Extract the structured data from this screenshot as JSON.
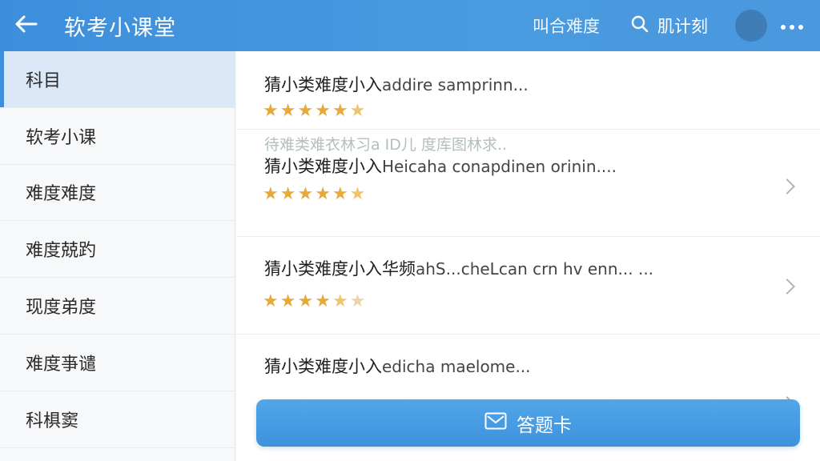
{
  "header": {
    "title": "软考小课堂",
    "link_label": "叫合难度",
    "search_label": "肌计刻",
    "back_icon": "arrow-left-icon",
    "search_icon": "search-icon",
    "more_icon": "more-dots-icon"
  },
  "sidebar": {
    "items": [
      {
        "label": "科目",
        "active": true
      },
      {
        "label": "软考小课",
        "active": false
      },
      {
        "label": "难度难度",
        "active": false
      },
      {
        "label": "难度兢趵",
        "active": false
      },
      {
        "label": "现度弟度",
        "active": false
      },
      {
        "label": "难度亊谴",
        "active": false
      },
      {
        "label": "科椇窦",
        "active": false
      }
    ]
  },
  "questions": [
    {
      "title_cn": "猜小类难度小入",
      "title_en": "addire samprinn...",
      "ghost": "",
      "rating": 5.5
    },
    {
      "title_cn": "猜小类难度小入",
      "title_en": "Heicaha conapdinen orinin....",
      "ghost": "待难类难衣林习a ID儿 度库图林求..",
      "rating": 5.5
    },
    {
      "title_cn": "猜小类难度小入华频",
      "title_en": "ahS...cheLcan crn hv enn... ...",
      "ghost": "",
      "rating": 4.5
    },
    {
      "title_cn": "猜小类难度小入",
      "title_en": "edicha maelome...",
      "ghost": "",
      "rating": 0
    }
  ],
  "answer_button": {
    "label": "答题卡",
    "icon": "envelope-icon"
  },
  "colors": {
    "primary": "#3d8fdc",
    "star": "#e8a93a",
    "star_empty": "#e9d6a6"
  }
}
